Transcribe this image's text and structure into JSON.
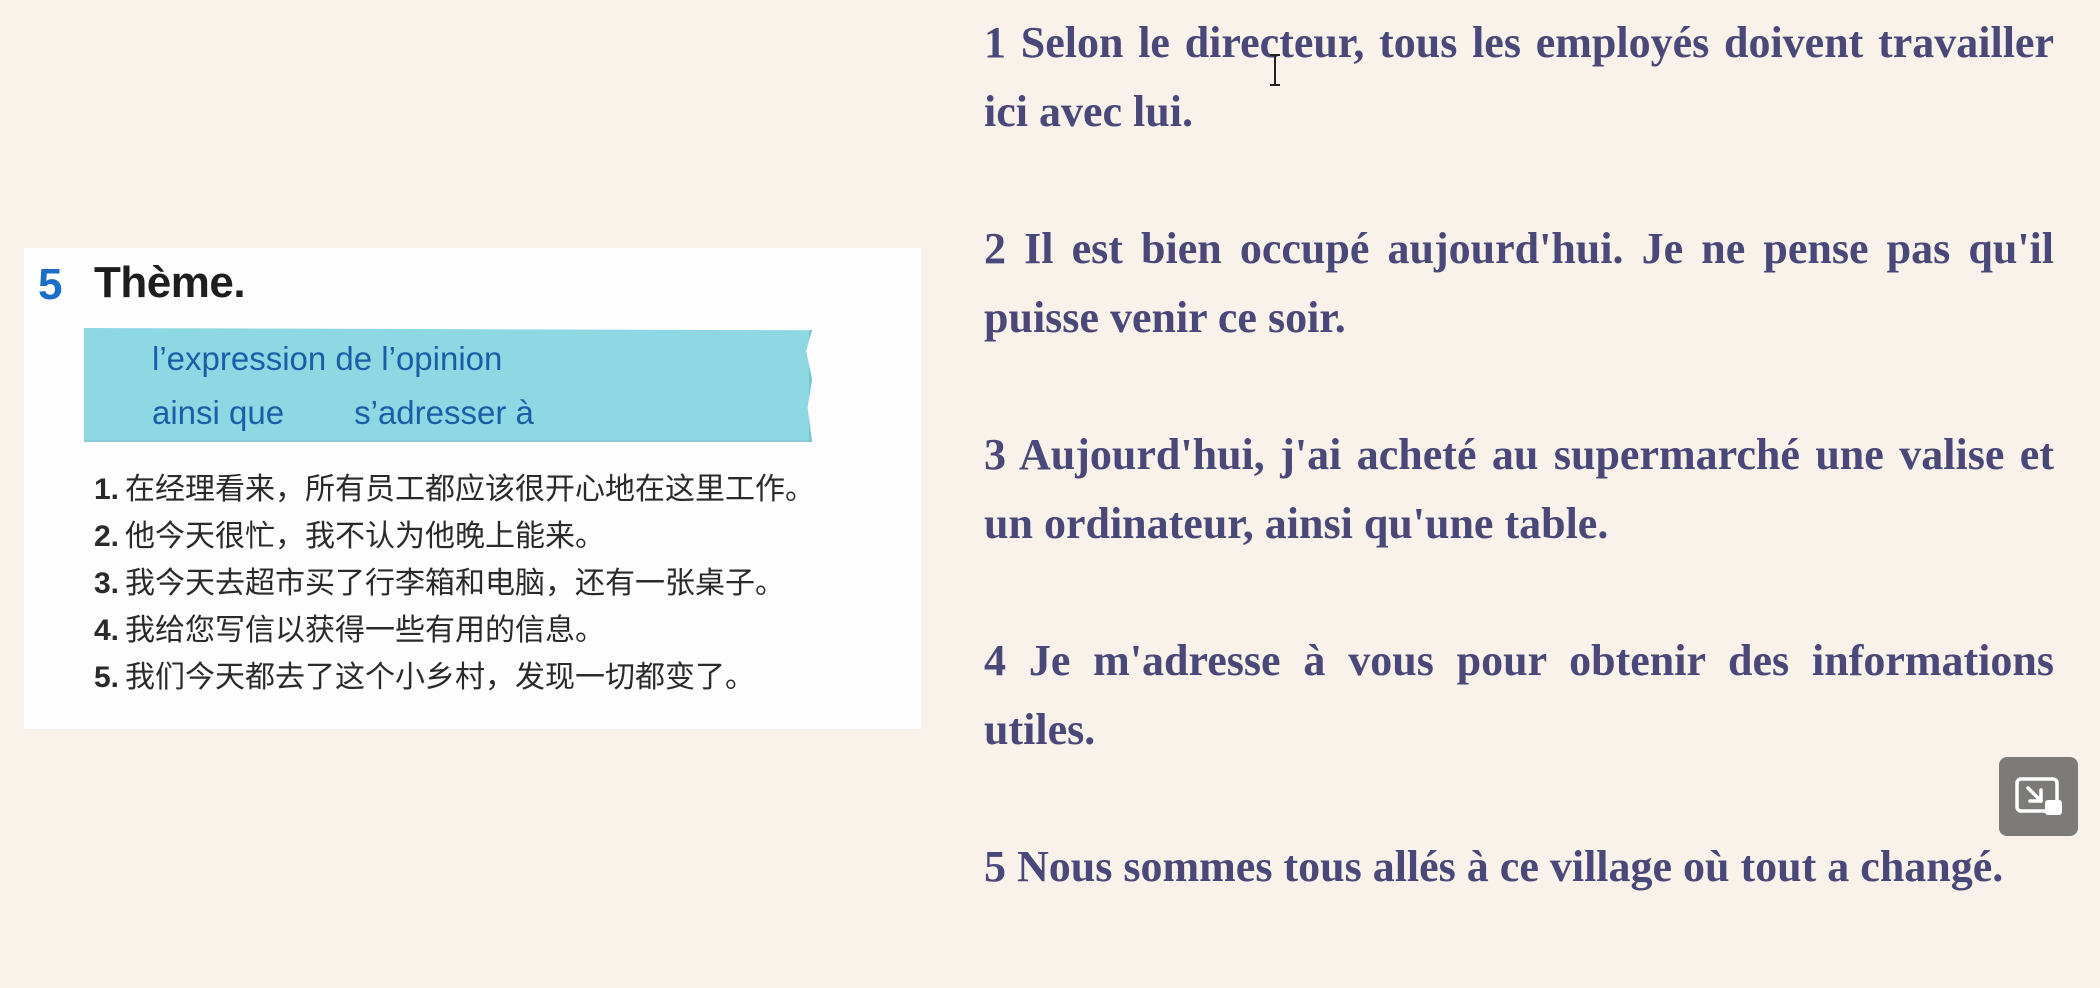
{
  "textbook": {
    "exercise_number": "5",
    "exercise_title": "Thème.",
    "theme_line1": "l’expression de l’opinion",
    "theme_word1": "ainsi que",
    "theme_word2": "s’adresser à",
    "items": [
      {
        "num": "1.",
        "text": "在经理看来，所有员工都应该很开心地在这里工作。"
      },
      {
        "num": "2.",
        "text": "他今天很忙，我不认为他晚上能来。"
      },
      {
        "num": "3.",
        "text": "我今天去超市买了行李箱和电脑，还有一张桌子。"
      },
      {
        "num": "4.",
        "text": "我给您写信以获得一些有用的信息。"
      },
      {
        "num": "5.",
        "text": "我们今天都去了这个小乡村，发现一切都变了。"
      }
    ]
  },
  "translations": [
    "1 Selon le directeur, tous les employés doivent travailler ici avec lui.",
    "2 Il est bien occupé aujourd'hui. Je ne pense pas qu'il puisse venir ce soir.",
    "3 Aujourd'hui, j'ai acheté au supermarché une valise et un ordinateur,  ainsi qu'une table.",
    "4 Je m'adresse à vous pour obtenir des informations utiles.",
    "5 Nous sommes tous allés à ce village où tout a changé."
  ],
  "icons": {
    "cursor": "text-cursor-icon",
    "pip": "exit-picture-in-picture-icon"
  },
  "colors": {
    "background": "#f8f2ea",
    "translation_text": "#4a4878",
    "banner": "#8ed8e3",
    "banner_text": "#1b5ea8",
    "exercise_number": "#1b6fc6"
  }
}
